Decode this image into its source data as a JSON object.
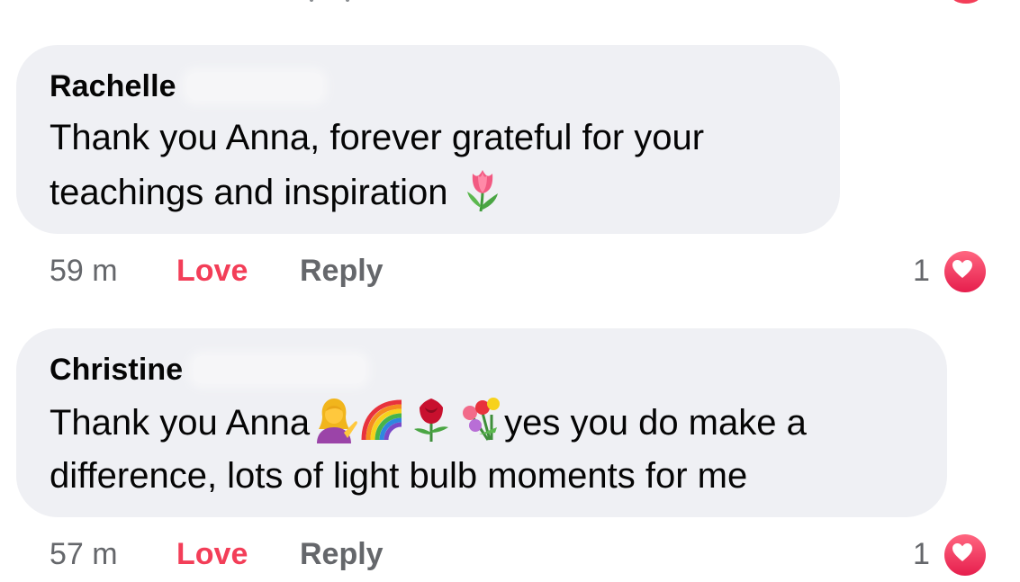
{
  "comments": [
    {
      "author": "Rachelle",
      "lines": [
        "Thank you Anna, forever grateful for your",
        "teachings and inspiration"
      ],
      "trailing_emoji": "tulip-emoji",
      "time": "59 m",
      "love_label": "Love",
      "reply_label": "Reply",
      "reaction_count": "1",
      "reaction_icon": "heart-icon"
    },
    {
      "author": "Christine",
      "line1_before": "Thank you Anna",
      "line1_emojis": [
        "woman-tipping-hand-emoji",
        "rainbow-emoji",
        "rose-emoji",
        "bouquet-emoji"
      ],
      "line1_after": "yes you do make a",
      "line2": "difference, lots of light bulb moments for me",
      "time": "57 m",
      "love_label": "Love",
      "reply_label": "Reply",
      "reaction_count": "1",
      "reaction_icon": "heart-icon"
    }
  ],
  "colors": {
    "bubble": "#eff0f4",
    "love_active": "#f33e58",
    "secondary_text": "#65676b",
    "heart_badge": "#f33e58"
  }
}
